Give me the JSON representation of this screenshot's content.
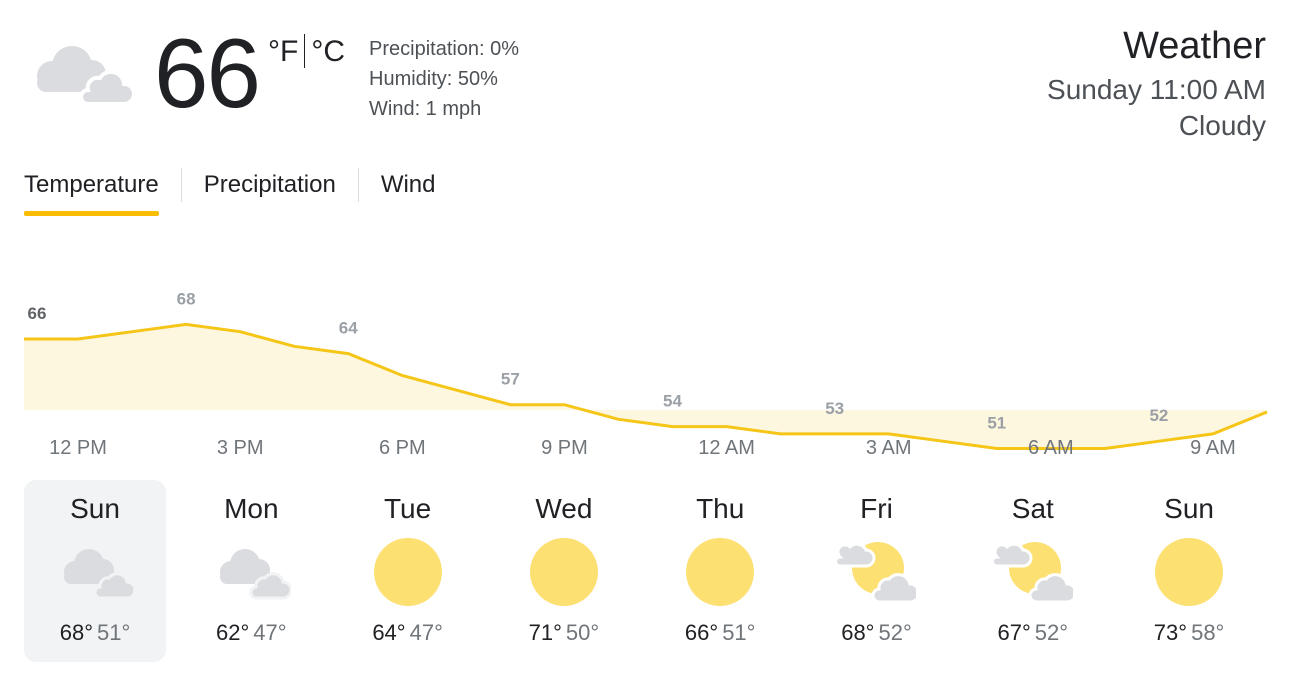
{
  "current": {
    "icon": "cloudy-icon",
    "temperature": "66",
    "unit_f": "°F",
    "unit_c": "°C",
    "precipitation": "Precipitation: 0%",
    "humidity": "Humidity: 50%",
    "wind": "Wind: 1 mph"
  },
  "header": {
    "title": "Weather",
    "datetime": "Sunday 11:00 AM",
    "condition": "Cloudy"
  },
  "tabs": [
    {
      "label": "Temperature",
      "active": true
    },
    {
      "label": "Precipitation",
      "active": false
    },
    {
      "label": "Wind",
      "active": false
    }
  ],
  "colors": {
    "accent": "#fbbc04",
    "chart_line": "#f5c518",
    "chart_fill": "#fef7e0",
    "sun": "#fde072",
    "cloud": "#dadce0"
  },
  "chart_data": {
    "type": "area",
    "x": [
      "11 AM",
      "12 PM",
      "1 PM",
      "2 PM",
      "3 PM",
      "4 PM",
      "5 PM",
      "6 PM",
      "7 PM",
      "8 PM",
      "9 PM",
      "10 PM",
      "11 PM",
      "12 AM",
      "1 AM",
      "2 AM",
      "3 AM",
      "4 AM",
      "5 AM",
      "6 AM",
      "7 AM",
      "8 AM",
      "9 AM",
      "10 AM"
    ],
    "values": [
      66,
      66,
      67,
      68,
      67,
      65,
      64,
      61,
      59,
      57,
      57,
      55,
      54,
      54,
      53,
      53,
      53,
      52,
      51,
      51,
      51,
      52,
      53,
      56
    ],
    "labels": [
      {
        "index": 0,
        "value": "66"
      },
      {
        "index": 3,
        "value": "68"
      },
      {
        "index": 6,
        "value": "64"
      },
      {
        "index": 9,
        "value": "57"
      },
      {
        "index": 12,
        "value": "54"
      },
      {
        "index": 15,
        "value": "53"
      },
      {
        "index": 18,
        "value": "51"
      },
      {
        "index": 21,
        "value": "52"
      }
    ],
    "tick_labels": [
      "12 PM",
      "3 PM",
      "6 PM",
      "9 PM",
      "12 AM",
      "3 AM",
      "6 AM",
      "9 AM"
    ],
    "ylim": [
      40,
      75
    ],
    "grid": false
  },
  "forecast": [
    {
      "day": "Sun",
      "icon": "cloudy-icon",
      "high": "68°",
      "low": "51°",
      "selected": true
    },
    {
      "day": "Mon",
      "icon": "cloudy-icon",
      "high": "62°",
      "low": "47°",
      "selected": false
    },
    {
      "day": "Tue",
      "icon": "sunny-icon",
      "high": "64°",
      "low": "47°",
      "selected": false
    },
    {
      "day": "Wed",
      "icon": "sunny-icon",
      "high": "71°",
      "low": "50°",
      "selected": false
    },
    {
      "day": "Thu",
      "icon": "sunny-icon",
      "high": "66°",
      "low": "51°",
      "selected": false
    },
    {
      "day": "Fri",
      "icon": "partly-cloudy-icon",
      "high": "68°",
      "low": "52°",
      "selected": false
    },
    {
      "day": "Sat",
      "icon": "partly-cloudy-icon",
      "high": "67°",
      "low": "52°",
      "selected": false
    },
    {
      "day": "Sun",
      "icon": "sunny-icon",
      "high": "73°",
      "low": "58°",
      "selected": false
    }
  ]
}
